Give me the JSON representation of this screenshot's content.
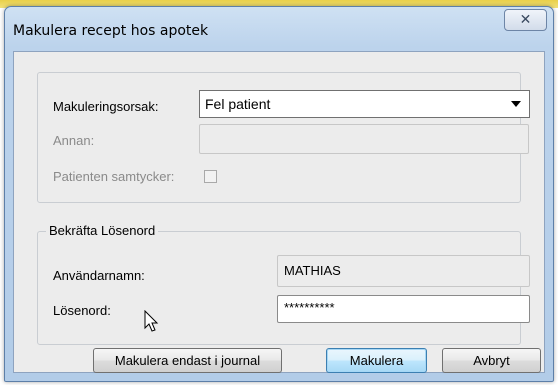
{
  "window": {
    "title": "Makulera recept hos apotek",
    "close_glyph": "✕"
  },
  "reason": {
    "label": "Makuleringsorsak:",
    "selected": "Fel patient",
    "other_label": "Annan:",
    "other_value": "",
    "consent_label": "Patienten samtycker:",
    "consent_checked": false
  },
  "confirm": {
    "legend": "Bekräfta Lösenord",
    "username_label": "Användarnamn:",
    "username_value": "MATHIAS",
    "password_label": "Lösenord:",
    "password_value": "**********"
  },
  "buttons": {
    "journal_only": "Makulera endast i journal",
    "submit": "Makulera",
    "cancel": "Avbryt"
  }
}
